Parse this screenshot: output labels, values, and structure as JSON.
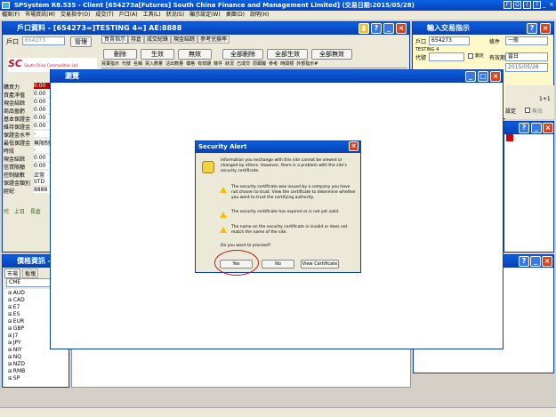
{
  "app": {
    "title": "SPSystem R8.535 - Client [654273a[Futures] South China Finance and Management Limited] (交易日期:2015/05/28)",
    "menu": [
      "檔案(F)",
      "市場資訊(M)",
      "交易指令(O)",
      "成交(T)",
      "戶口(A)",
      "工具(L)",
      "狀況(S)",
      "顯示設定(W)",
      "桌面(D)",
      "說明(H)"
    ],
    "right_icons": [
      "F",
      "O",
      "I",
      "?"
    ]
  },
  "account_window": {
    "title": "戶口資料 - [654273=]TESTING 4=] AE:8888",
    "account_label": "戶口",
    "account_value": "654273",
    "manage_btn": "管理",
    "logo_text": "SC",
    "logo_sub": "South China Commodities Ltd.",
    "tabs": [
      "買賣指示",
      "持倉",
      "成交紀錄",
      "現金結餘",
      "參考兌換率"
    ],
    "actions": [
      "刪除",
      "生效",
      "無效",
      "全部刪除",
      "全部生效",
      "全部無效"
    ],
    "columns": [
      "買賣指示",
      "代號",
      "名稱",
      "買入數量",
      "沽出數量",
      "價格",
      "有效期",
      "條件",
      "狀況",
      "已成交",
      "原跟蹤",
      "參考",
      "時間標",
      "外部指示#"
    ],
    "fields": [
      {
        "label": "購買力",
        "value": "0.00"
      },
      {
        "label": "資產淨值",
        "value": "0.00"
      },
      {
        "label": "現金結餘",
        "value": "0.00"
      },
      {
        "label": "商品盈虧",
        "value": "0.00"
      },
      {
        "label": "基本保證金",
        "value": "0.00"
      },
      {
        "label": "維持保證金",
        "value": "0.00"
      },
      {
        "label": "保證金水平",
        "value": "-"
      },
      {
        "label": "最低保證金",
        "value": "無限制"
      },
      {
        "label": "時段",
        "value": "-"
      },
      {
        "label": "現金結餘",
        "value": "0.00"
      },
      {
        "label": "信貸限額",
        "value": "0.00"
      },
      {
        "label": "控制級數",
        "value": "正常"
      },
      {
        "label": "保證金類別",
        "value": "STD"
      },
      {
        "label": "經紀",
        "value": "8888"
      }
    ],
    "bottom_tabs": [
      "代",
      "上日",
      "長倉"
    ]
  },
  "price_window": {
    "title": "價格資訊 - ",
    "tabs": [
      "市場",
      "板塊"
    ],
    "search_value": "CME",
    "items": [
      "AUD",
      "CAD",
      "E7",
      "ES",
      "EUR",
      "GBP",
      "J7",
      "JPY",
      "NIY",
      "NQ",
      "NZD",
      "RMB",
      "SP"
    ]
  },
  "order_window": {
    "title": "輸入交易指示",
    "account_label": "戶口",
    "account_value": "654273",
    "condition_label": "條件",
    "condition_value": "一般",
    "name": "TESTING 4",
    "code_label": "代號",
    "valid_label": "有效期",
    "valid_value": "當日",
    "date_value": "2015/05/28",
    "lock_label": "鎖定",
    "right_labels": [
      "鎖定",
      "1+1",
      "設定",
      "無效"
    ]
  },
  "browser_window": {
    "title": "瀏覽"
  },
  "dialog": {
    "title": "Security Alert",
    "intro": "Information you exchange with this site cannot be viewed or changed by others. However, there is a problem with the site's security certificate.",
    "warnings": [
      "The security certificate was issued by a company you have not chosen to trust. View the certificate to determine whether you want to trust the certifying authority.",
      "The security certificate has expired or is not yet valid.",
      "The name on the security certificate is invalid or does not match the name of the site."
    ],
    "question": "Do you want to proceed?",
    "yes": "Yes",
    "no": "No",
    "view": "View Certificate"
  }
}
